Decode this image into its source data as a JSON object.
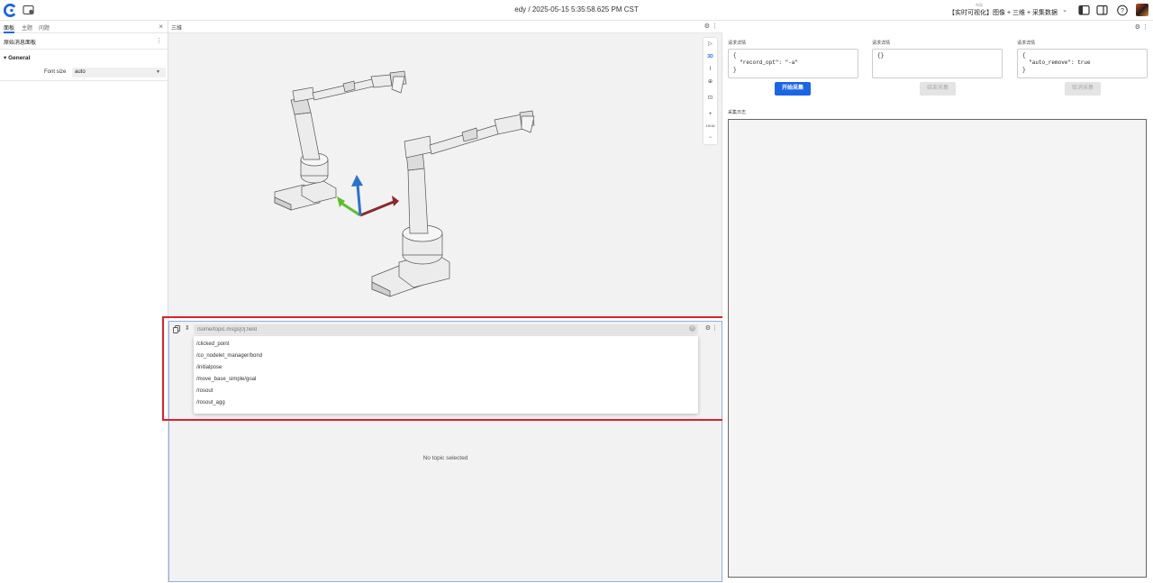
{
  "topbar": {
    "title": "edy / 2025-05-15 5:35:58.625 PM CST",
    "layout_sublabel": "布局",
    "layout_name": "【实时可视化】图像 + 三维 + 采集数据",
    "layout_chevron": "⌄",
    "icons": [
      "app-logo-icon",
      "new-window-icon",
      "left-sidebar-icon",
      "right-sidebar-icon",
      "help-icon",
      "user-avatar"
    ]
  },
  "left_panel": {
    "tabs": [
      {
        "label": "面板",
        "active": true
      },
      {
        "label": "主题",
        "active": false
      },
      {
        "label": "问题",
        "active": false
      }
    ],
    "close": "×",
    "panel_name": "原始消息面板",
    "menu": "⋮",
    "section_title": "General",
    "font_size_label": "Font size",
    "font_size_value": "auto"
  },
  "three_panel": {
    "title": "三维",
    "gear": "⚙",
    "more": "⋮",
    "tools": [
      "▷",
      "3D",
      "⌇",
      "⊕",
      "⊡",
      "+",
      "19/16",
      "−"
    ]
  },
  "raw_panel": {
    "path_placeholder": "/some/topic.msgs[0].field",
    "topics": [
      "/clicked_point",
      "/co_nodelet_manager/bond",
      "/initialpose",
      "/move_base_simple/goal",
      "/rosout",
      "/rosout_agg"
    ],
    "empty_text": "No topic selected",
    "expand": "⇕",
    "clear": "×",
    "gear": "⚙",
    "more": "⋮"
  },
  "right_panel": {
    "gear": "⚙",
    "more": "⋮",
    "columns": [
      {
        "label": "请求详情",
        "body": "{\n  \"record_opt\": \"-a\"\n}",
        "button": "开始采集",
        "button_state": "primary"
      },
      {
        "label": "请求详情",
        "body": "{}",
        "button": "结束采集",
        "button_state": "disabled"
      },
      {
        "label": "请求详情",
        "body": "{\n  \"auto_remove\": true\n}",
        "button": "取消采集",
        "button_state": "disabled"
      }
    ],
    "log_label": "采集日志",
    "log_text": ""
  },
  "colors": {
    "accent": "#1a65e6",
    "highlight": "#e0202a",
    "axis_x": "#8a2a2a",
    "axis_y": "#5cbf2a",
    "axis_z": "#2a72d0"
  }
}
